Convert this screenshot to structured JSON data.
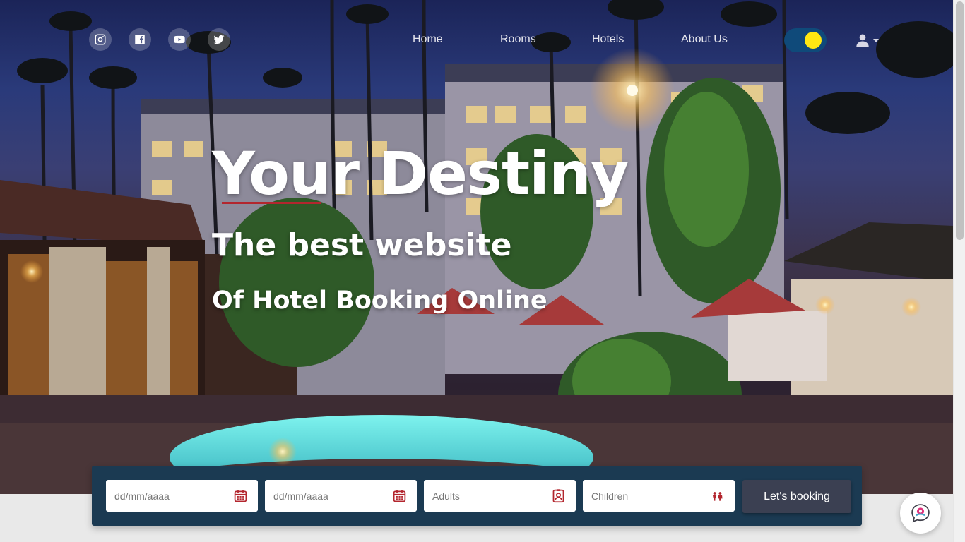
{
  "nav": {
    "links": [
      "Home",
      "Rooms",
      "Hotels",
      "About Us"
    ]
  },
  "social": [
    "instagram-icon",
    "facebook-icon",
    "youtube-icon",
    "twitter-icon"
  ],
  "hero": {
    "title": "Your Destiny",
    "subtitle": "The best website",
    "tagline": "Of Hotel Booking Online"
  },
  "booking": {
    "checkin_placeholder": "dd/mm/aaaa",
    "checkout_placeholder": "dd/mm/aaaa",
    "adults_placeholder": "Adults",
    "children_placeholder": "Children",
    "submit_label": "Let's booking"
  },
  "colors": {
    "accent_red": "#b3262e",
    "booking_bar": "#1b3a52",
    "toggle_track": "#0f4a7a",
    "toggle_knob": "#ffe812",
    "button": "#3b4052"
  }
}
